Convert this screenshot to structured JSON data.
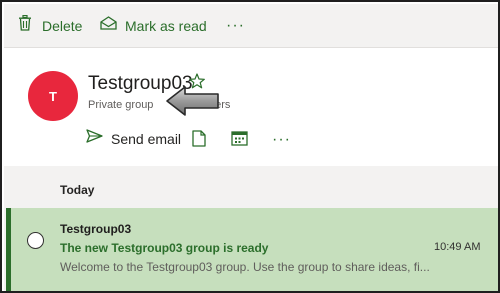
{
  "toolbar": {
    "delete_label": "Delete",
    "mark_read_label": "Mark as read",
    "more_label": "···"
  },
  "group": {
    "avatar_initial": "T",
    "name": "Testgroup03",
    "privacy": "Private group",
    "members_fragment": "bers",
    "send_email_label": "Send email",
    "more_label": "···"
  },
  "list": {
    "date_header": "Today",
    "message": {
      "sender": "Testgroup03",
      "subject": "The new Testgroup03 group is ready",
      "time": "10:49 AM",
      "preview": "Welcome to the Testgroup03 group. Use the group to share ideas, fi..."
    }
  },
  "colors": {
    "accent": "#2b6e2b",
    "avatar": "#e8273d",
    "selected_row": "#c6dfbd"
  },
  "icons": [
    "trash-icon",
    "envelope-open-icon",
    "star-icon",
    "send-icon",
    "file-icon",
    "calendar-icon",
    "arrow-pointer-icon"
  ]
}
